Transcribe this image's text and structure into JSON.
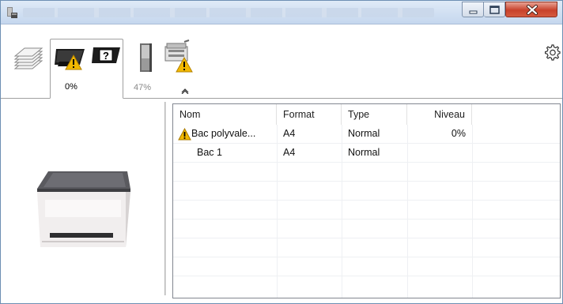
{
  "window": {
    "controls": {
      "minimize": "minimize",
      "maximize": "maximize",
      "close": "close"
    }
  },
  "toolbar": {
    "tabs": [
      {
        "name": "paper-stack",
        "pct": ""
      },
      {
        "name": "toner-cartridges",
        "pct": "0%"
      },
      {
        "name": "waste-toner",
        "pct": "47%"
      },
      {
        "name": "device-status",
        "pct": ""
      }
    ],
    "waste_toner_level": 0.47,
    "collapse_icon": "chevron-up-icon",
    "settings_icon": "gear-icon"
  },
  "trays": {
    "columns": [
      "Nom",
      "Format",
      "Type",
      "Niveau"
    ],
    "rows": [
      {
        "name": "Bac polyvale...",
        "format": "A4",
        "type": "Normal",
        "level": "0%",
        "warning": true
      },
      {
        "name": "Bac 1",
        "format": "A4",
        "type": "Normal",
        "level": "",
        "warning": false
      }
    ]
  },
  "colors": {
    "warning": "#f2b800",
    "titlebar": "#c5d7ee",
    "close": "#c8412b"
  }
}
